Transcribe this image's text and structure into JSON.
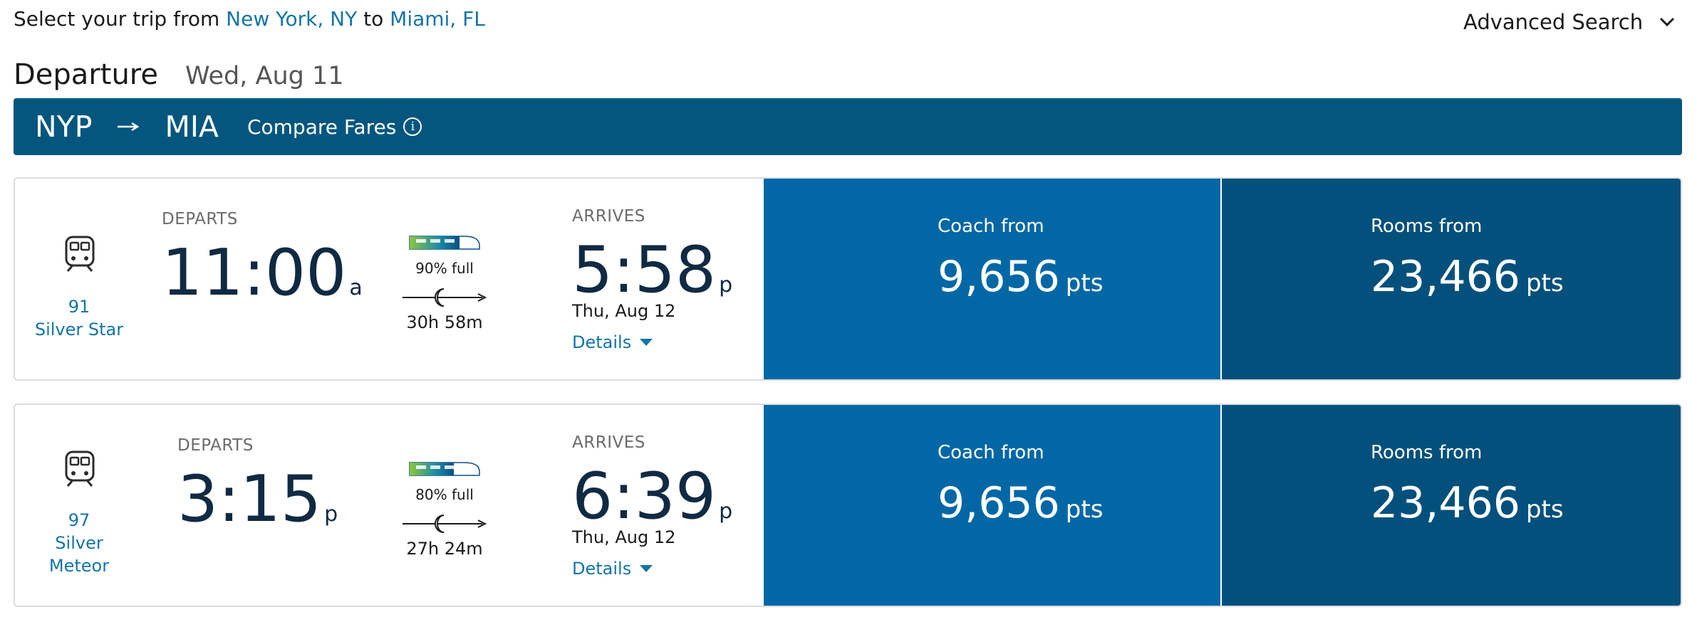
{
  "header": {
    "select_prefix": "Select your trip from",
    "origin": "New York, NY",
    "to_word": "to",
    "destination": "Miami, FL",
    "advanced_search": "Advanced Search"
  },
  "departure": {
    "title": "Departure",
    "date": "Wed, Aug 11"
  },
  "route": {
    "from_code": "NYP",
    "arrow": "→",
    "to_code": "MIA",
    "compare_fares": "Compare Fares",
    "info_glyph": "i"
  },
  "trains": [
    {
      "number": "91",
      "name_line1": "Silver Star",
      "name_line2": "",
      "departs_label": "DEPARTS",
      "depart_time": "11:00",
      "depart_ampm": "a",
      "occupancy_text": "90% full",
      "occupancy_fraction": 0.9,
      "duration": "30h 58m",
      "arrives_label": "ARRIVES",
      "arrive_time": "5:58",
      "arrive_ampm": "p",
      "arrive_date": "Thu, Aug 12",
      "details": "Details",
      "coach_label": "Coach from",
      "coach_price": "9,656",
      "rooms_label": "Rooms from",
      "rooms_price": "23,466",
      "unit": "pts"
    },
    {
      "number": "97",
      "name_line1": "Silver",
      "name_line2": "Meteor",
      "departs_label": "DEPARTS",
      "depart_time": "3:15",
      "depart_ampm": "p",
      "occupancy_text": "80% full",
      "occupancy_fraction": 0.8,
      "duration": "27h 24m",
      "arrives_label": "ARRIVES",
      "arrive_time": "6:39",
      "arrive_ampm": "p",
      "arrive_date": "Thu, Aug 12",
      "details": "Details",
      "coach_label": "Coach from",
      "coach_price": "9,656",
      "rooms_label": "Rooms from",
      "rooms_price": "23,466",
      "unit": "pts"
    }
  ],
  "icons": {
    "train": "train-icon",
    "chevron": "chevron-down-icon",
    "caret": "caret-down-icon",
    "overnight": "moon-icon",
    "info": "info-icon"
  },
  "colors": {
    "link": "#1474a6",
    "route_bar": "#04567f",
    "coach_bg": "#0367a6",
    "rooms_bg": "#04507c",
    "time_text": "#102a43"
  }
}
